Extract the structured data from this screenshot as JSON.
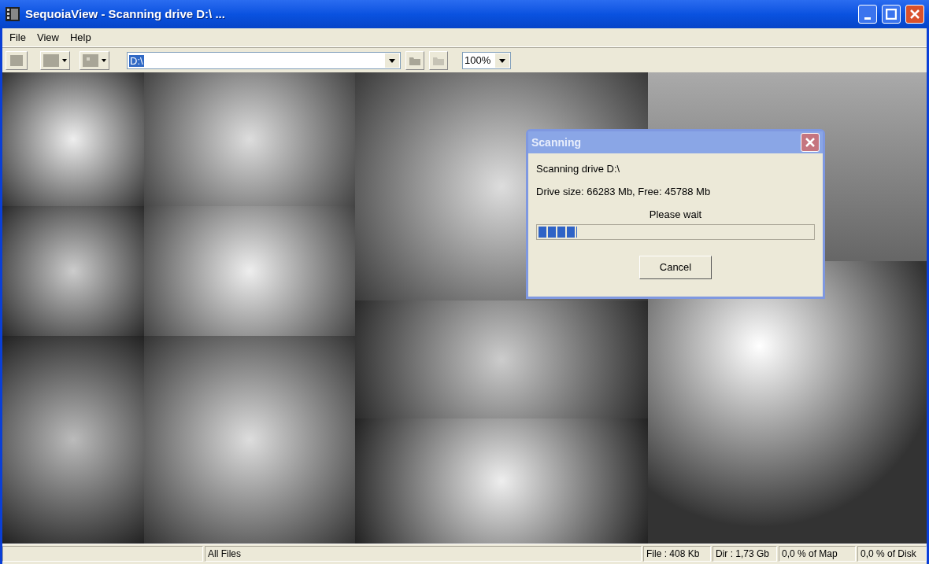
{
  "window": {
    "title": "SequoiaView - Scanning drive D:\\ ..."
  },
  "menu": [
    "File",
    "View",
    "Help"
  ],
  "toolbar": {
    "path": "D:\\",
    "zoom": "100%"
  },
  "dialog": {
    "title": "Scanning",
    "lines": [
      "Scanning drive D:\\",
      "Drive size: 66283 Mb, Free: 45788 Mb"
    ],
    "message": "Please wait",
    "progress": {
      "level": 0.14
    },
    "button": "Cancel"
  },
  "status_bar": [
    "All Files",
    "File : 408 Kb",
    "Dir : 1,73 Gb",
    "0,0 % of Map",
    "0,0 % of Disk"
  ]
}
